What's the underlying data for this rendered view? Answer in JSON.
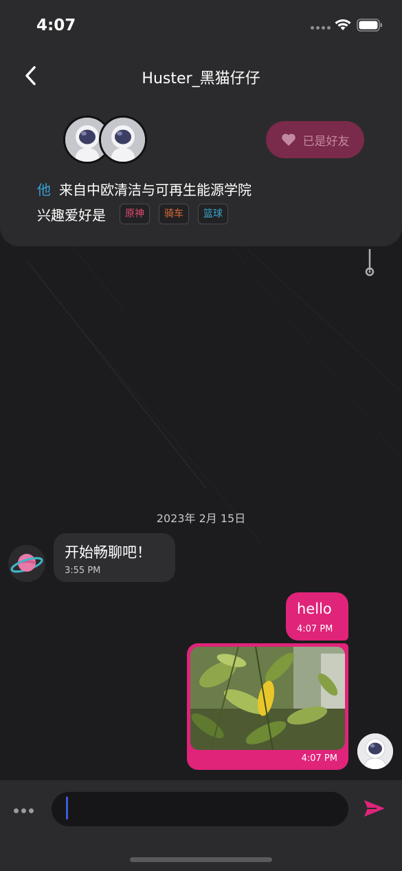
{
  "status_bar": {
    "time": "4:07"
  },
  "header": {
    "title": "Huster_黑猫仔仔"
  },
  "profile": {
    "friend_button_label": "已是好友",
    "pronoun": "他",
    "from_text": "来自中欧清洁与可再生能源学院",
    "hobby_label": "兴趣爱好是",
    "tags": [
      "原神",
      "骑车",
      "篮球"
    ]
  },
  "chat": {
    "date_divider": "2023年 2月 15日",
    "messages": [
      {
        "direction": "incoming",
        "text": "开始畅聊吧！",
        "time": "3:55 PM"
      },
      {
        "direction": "outgoing",
        "text": "hello",
        "time": "4:07 PM"
      },
      {
        "direction": "outgoing",
        "type": "image",
        "time": "4:07 PM"
      }
    ]
  },
  "composer": {
    "input_value": "",
    "placeholder": ""
  },
  "colors": {
    "accent": "#e0247a",
    "friend_button_bg": "#7a2a4a",
    "pronoun_color": "#37a2d8",
    "caret": "#3d5bd9"
  },
  "icons": [
    "back-chevron-icon",
    "heart-icon",
    "wifi-icon",
    "battery-icon",
    "send-icon",
    "more-icon"
  ]
}
